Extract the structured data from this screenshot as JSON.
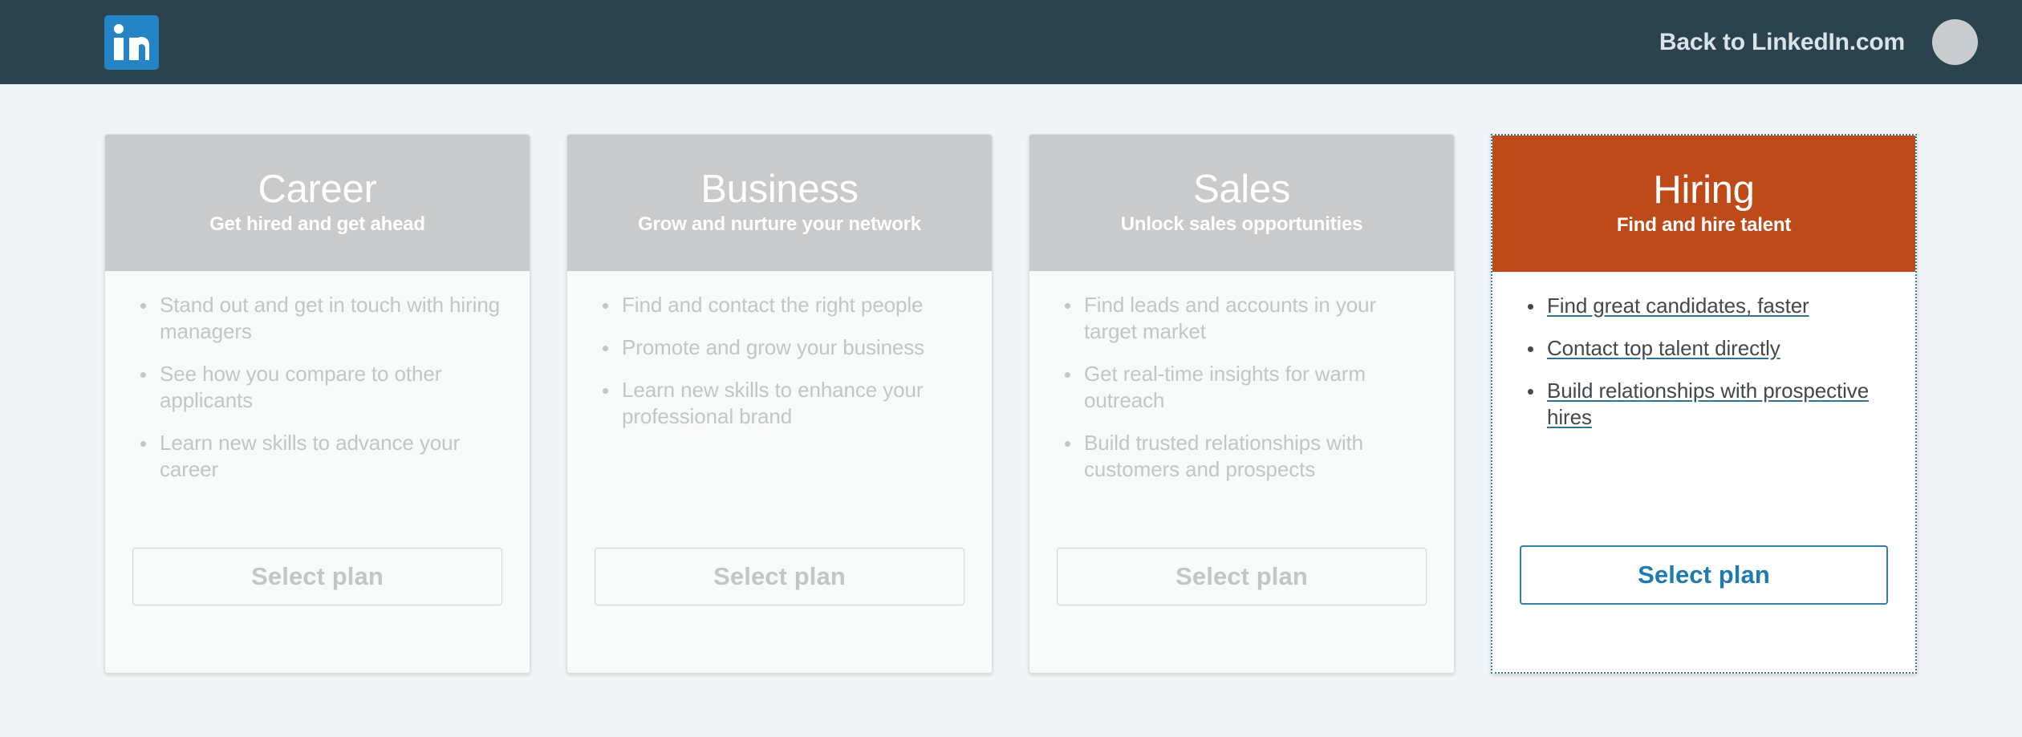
{
  "navbar": {
    "logo_icon": "linkedin-logo-icon",
    "back_link_label": "Back to LinkedIn.com",
    "avatar_icon": "user-avatar-icon",
    "background_color": "#2a434f",
    "logo_color": "#2484c6"
  },
  "page": {
    "background_color": "#f0f4f7",
    "accent_color": "#bf4a19",
    "link_color": "#1f7ab0"
  },
  "plans": [
    {
      "id": "career",
      "title": "Career",
      "subtitle": "Get hired and get ahead",
      "selected": false,
      "header_color": "#c9cacb",
      "bullets": [
        "Stand out and get in touch with hiring managers",
        "See how you compare to other applicants",
        "Learn new skills to advance your career"
      ],
      "cta_label": "Select plan"
    },
    {
      "id": "business",
      "title": "Business",
      "subtitle": "Grow and nurture your network",
      "selected": false,
      "header_color": "#c9cacb",
      "bullets": [
        "Find and contact the right people",
        "Promote and grow your business",
        "Learn new skills to enhance your professional brand"
      ],
      "cta_label": "Select plan"
    },
    {
      "id": "sales",
      "title": "Sales",
      "subtitle": "Unlock sales opportunities",
      "selected": false,
      "header_color": "#c9cacb",
      "bullets": [
        "Find leads and accounts in your target market",
        "Get real-time insights for warm outreach",
        "Build trusted relationships with customers and prospects"
      ],
      "cta_label": "Select plan"
    },
    {
      "id": "hiring",
      "title": "Hiring",
      "subtitle": "Find and hire talent",
      "selected": true,
      "header_color": "#bf4a19",
      "bullets": [
        "Find great candidates, faster",
        "Contact top talent directly",
        "Build relationships with prospective hires"
      ],
      "cta_label": "Select plan"
    }
  ]
}
